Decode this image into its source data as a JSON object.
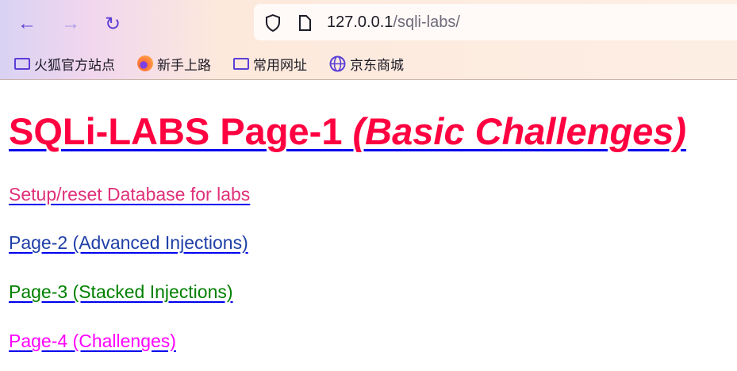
{
  "browser": {
    "url_host": "127.0.0.1",
    "url_path": "/sqli-labs/",
    "bookmarks": [
      {
        "label": "火狐官方站点",
        "icon": "folder-icon"
      },
      {
        "label": "新手上路",
        "icon": "firefox-icon"
      },
      {
        "label": "常用网址",
        "icon": "folder-icon"
      },
      {
        "label": "京东商城",
        "icon": "globe-icon"
      }
    ]
  },
  "page": {
    "title": "SQLi-LABS Page-1",
    "title_italic": "(Basic Challenges)",
    "links": [
      {
        "label": "Setup/reset Database for labs",
        "color": "#e0307a"
      },
      {
        "label": "Page-2 (Advanced Injections)",
        "color": "#1f3fa8"
      },
      {
        "label": "Page-3 (Stacked Injections)",
        "color": "#008000"
      },
      {
        "label": "Page-4 (Challenges)",
        "color": "#ff00ff"
      }
    ]
  }
}
